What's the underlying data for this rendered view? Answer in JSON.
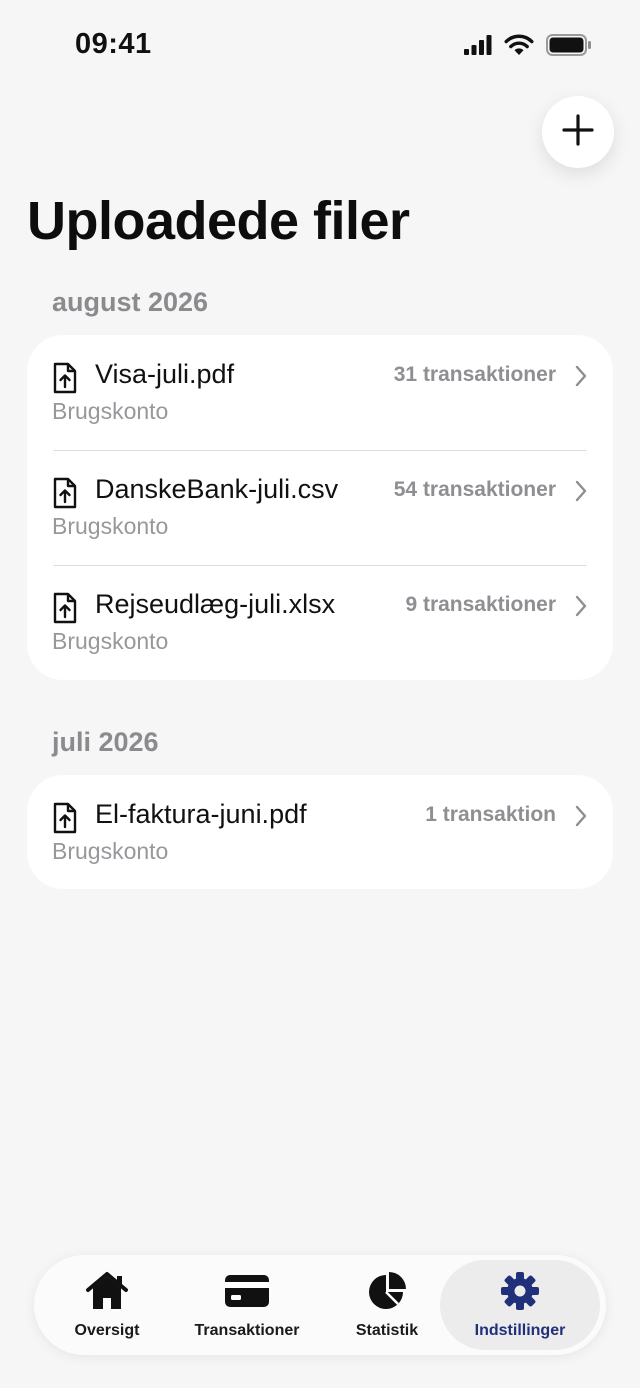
{
  "status_bar": {
    "time": "09:41",
    "icons": [
      "signal-icon",
      "wifi-icon",
      "battery-icon"
    ]
  },
  "header": {
    "title": "Uploadede filer",
    "add_button_icon": "plus-icon"
  },
  "sections": [
    {
      "title": "august 2026",
      "files": [
        {
          "name": "Visa-juli.pdf",
          "account": "Brugskonto",
          "count": "31 transaktioner"
        },
        {
          "name": "DanskeBank-juli.csv",
          "account": "Brugskonto",
          "count": "54 transaktioner"
        },
        {
          "name": "Rejseudlæg-juli.xlsx",
          "account": "Brugskonto",
          "count": "9 transaktioner"
        }
      ]
    },
    {
      "title": "juli 2026",
      "files": [
        {
          "name": "El-faktura-juni.pdf",
          "account": "Brugskonto",
          "count": "1 transaktion"
        }
      ]
    }
  ],
  "tab_bar": {
    "tabs": [
      {
        "label": "Oversigt",
        "icon": "house-icon"
      },
      {
        "label": "Transaktioner",
        "icon": "credit-card-icon"
      },
      {
        "label": "Statistik",
        "icon": "pie-chart-icon"
      },
      {
        "label": "Indstillinger",
        "icon": "gear-icon",
        "active": true
      }
    ]
  },
  "colors": {
    "background": "#f6f6f6",
    "card": "#ffffff",
    "secondary_text": "#8e8e93",
    "active_tab": "#21307a"
  }
}
